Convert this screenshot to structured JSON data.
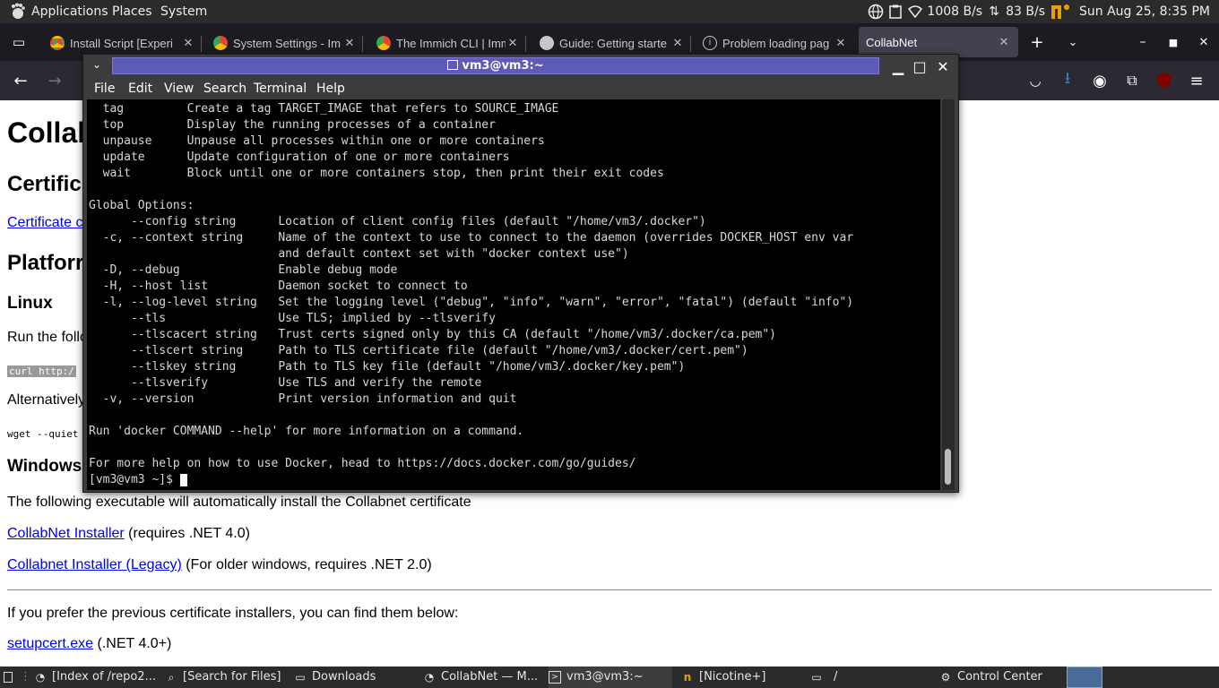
{
  "system_panel": {
    "menus": [
      "Applications",
      "Places",
      "System"
    ],
    "net_down": "1008 B/s",
    "net_up": "83 B/s",
    "clock": "Sun Aug 25,  8:35 PM"
  },
  "browser": {
    "tabs": [
      {
        "label": "Install Script [Experi",
        "icon": "chrome-icon"
      },
      {
        "label": "System Settings - Im",
        "icon": "chrome-icon"
      },
      {
        "label": "The Immich CLI | Imm",
        "icon": "chrome-icon"
      },
      {
        "label": "Guide: Getting starte",
        "icon": "github-icon"
      },
      {
        "label": "Problem loading pag",
        "icon": "info-icon"
      },
      {
        "label": "CollabNet",
        "icon": ""
      }
    ]
  },
  "page": {
    "h1": "Collal",
    "h2_cert": "Certific",
    "cert_link": "Certificate c",
    "h2_platform": "Platforr",
    "h3_linux": "Linux",
    "linux_text": "Run the follo",
    "curl_code": "curl http:/",
    "alt_text": "Alternatively",
    "wget_code": "wget --quiet",
    "h3_windows": "Windows",
    "windows_text": "The following executable will automatically install the Collabnet certificate",
    "installer_link": "CollabNet Installer",
    "installer_note": " (requires .NET 4.0)",
    "legacy_link": "Collabnet Installer (Legacy)",
    "legacy_note": " (For older windows, requires .NET 2.0)",
    "prev_text": "If you prefer the previous certificate installers, you can find them below:",
    "setup_link": "setupcert.exe",
    "setup_note": " (.NET 4.0+)"
  },
  "terminal": {
    "title": "vm3@vm3:~",
    "menu": [
      "File",
      "Edit",
      "View",
      "Search",
      "Terminal",
      "Help"
    ],
    "lines": [
      "  tag         Create a tag TARGET_IMAGE that refers to SOURCE_IMAGE",
      "  top         Display the running processes of a container",
      "  unpause     Unpause all processes within one or more containers",
      "  update      Update configuration of one or more containers",
      "  wait        Block until one or more containers stop, then print their exit codes",
      "",
      "Global Options:",
      "      --config string      Location of client config files (default \"/home/vm3/.docker\")",
      "  -c, --context string     Name of the context to use to connect to the daemon (overrides DOCKER_HOST env var",
      "                           and default context set with \"docker context use\")",
      "  -D, --debug              Enable debug mode",
      "  -H, --host list          Daemon socket to connect to",
      "  -l, --log-level string   Set the logging level (\"debug\", \"info\", \"warn\", \"error\", \"fatal\") (default \"info\")",
      "      --tls                Use TLS; implied by --tlsverify",
      "      --tlscacert string   Trust certs signed only by this CA (default \"/home/vm3/.docker/ca.pem\")",
      "      --tlscert string     Path to TLS certificate file (default \"/home/vm3/.docker/cert.pem\")",
      "      --tlskey string      Path to TLS key file (default \"/home/vm3/.docker/key.pem\")",
      "      --tlsverify          Use TLS and verify the remote",
      "  -v, --version            Print version information and quit",
      "",
      "Run 'docker COMMAND --help' for more information on a command.",
      "",
      "For more help on how to use Docker, head to https://docs.docker.com/go/guides/",
      "[vm3@vm3 ~]$ "
    ]
  },
  "taskbar": {
    "items": [
      {
        "label": "[Index of /repo2...",
        "icon": "firefox-icon"
      },
      {
        "label": "[Search for Files]",
        "icon": "search-icon"
      },
      {
        "label": "Downloads",
        "icon": "folder-icon"
      },
      {
        "label": "CollabNet — M...",
        "icon": "firefox-icon"
      },
      {
        "label": "vm3@vm3:~",
        "icon": "terminal-icon"
      },
      {
        "label": "[Nicotine+]",
        "icon": "nicotine-icon"
      },
      {
        "label": "/",
        "icon": "folder-icon"
      },
      {
        "label": "Control Center",
        "icon": "settings-icon"
      }
    ]
  }
}
